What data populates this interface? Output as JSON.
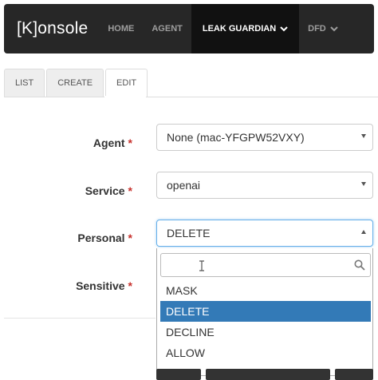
{
  "navbar": {
    "brand": "[K]onsole",
    "items": [
      {
        "label": "HOME"
      },
      {
        "label": "AGENT"
      },
      {
        "label": "LEAK GUARDIAN"
      },
      {
        "label": "DFD"
      }
    ]
  },
  "tabs": [
    {
      "label": "LIST"
    },
    {
      "label": "CREATE"
    },
    {
      "label": "EDIT"
    }
  ],
  "form": {
    "required_mark": "*",
    "agent": {
      "label": "Agent",
      "value": "None (mac-YFGPW52VXY)"
    },
    "service": {
      "label": "Service",
      "value": "openai"
    },
    "personal": {
      "label": "Personal",
      "value": "DELETE"
    },
    "sensitive": {
      "label": "Sensitive"
    }
  },
  "dropdown": {
    "search_value": "",
    "options": [
      {
        "label": "MASK"
      },
      {
        "label": "DELETE",
        "highlighted": true
      },
      {
        "label": "DECLINE"
      },
      {
        "label": "ALLOW"
      }
    ]
  },
  "colors": {
    "navbar_bg": "#272727",
    "active_nav_bg": "#111111",
    "highlight": "#337ab7",
    "required": "#c7302b"
  }
}
